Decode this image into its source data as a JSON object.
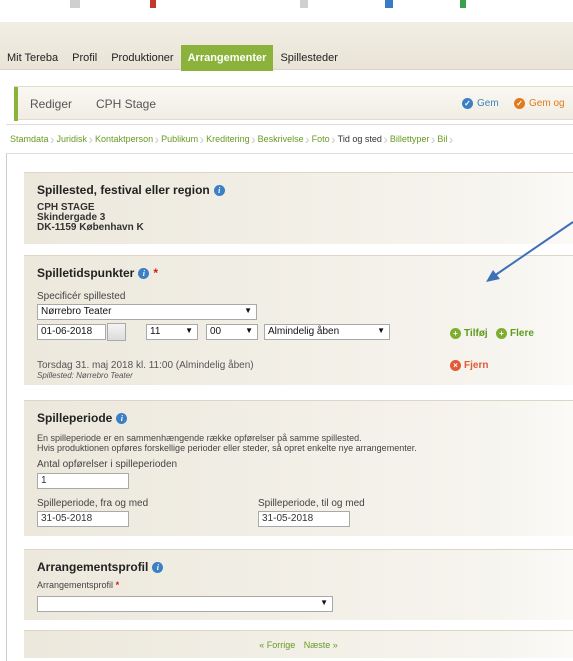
{
  "main_nav": {
    "items": [
      {
        "label": "Mit Tereba"
      },
      {
        "label": "Profil"
      },
      {
        "label": "Produktioner"
      },
      {
        "label": "Arrangementer",
        "active": true
      },
      {
        "label": "Spillesteder"
      }
    ]
  },
  "edit_bar": {
    "edit_label": "Rediger",
    "name": "CPH Stage",
    "save_label": "Gem",
    "save_other_label": "Gem og"
  },
  "tabs": [
    {
      "label": "Stamdata"
    },
    {
      "label": "Juridisk"
    },
    {
      "label": "Kontaktperson"
    },
    {
      "label": "Publikum"
    },
    {
      "label": "Kreditering"
    },
    {
      "label": "Beskrivelse"
    },
    {
      "label": "Foto"
    },
    {
      "label": "Tid og sted",
      "active": true
    },
    {
      "label": "Billettyper"
    },
    {
      "label": "Bil"
    }
  ],
  "venue": {
    "title": "Spillested, festival eller region",
    "line1": "CPH STAGE",
    "line2": "Skindergade 3",
    "line3": "DK-1159 København K"
  },
  "times": {
    "title": "Spilletidspunkter",
    "venue_label": "Specificér spillested",
    "venue_value": "Nørrebro Teater",
    "date_value": "01-06-2018",
    "hour_value": "11",
    "minute_value": "00",
    "status_value": "Almindelig åben",
    "add_label": "Tilføj",
    "more_label": "Flere",
    "entry_text": "Torsdag 31. maj 2018 kl. 11:00 (Almindelig åben)",
    "entry_venue": "Spillested: Nørrebro Teater",
    "remove_label": "Fjern"
  },
  "period": {
    "title": "Spilleperiode",
    "desc1": "En spilleperiode er en sammenhængende række opførelser på samme spillested.",
    "desc2": "Hvis produktionen opføres forskellige perioder eller steder, så opret enkelte nye arrangementer.",
    "count_label": "Antal opførelser i spilleperioden",
    "count_value": "1",
    "from_label": "Spilleperiode, fra og med",
    "from_value": "31-05-2018",
    "to_label": "Spilleperiode, til og med",
    "to_value": "31-05-2018"
  },
  "profile": {
    "title": "Arrangementsprofil",
    "field_label": "Arrangementsprofil",
    "field_value": ""
  },
  "pager": {
    "prev": "« Forrige",
    "next": "Næste »"
  },
  "colors": {
    "accent_green": "#8bb23b",
    "link_green": "#5d9b1e",
    "info_blue": "#3c7fc4",
    "arrow_blue": "#3e6fb8",
    "remove_red": "#e05a38",
    "required_red": "#d01a1a"
  }
}
